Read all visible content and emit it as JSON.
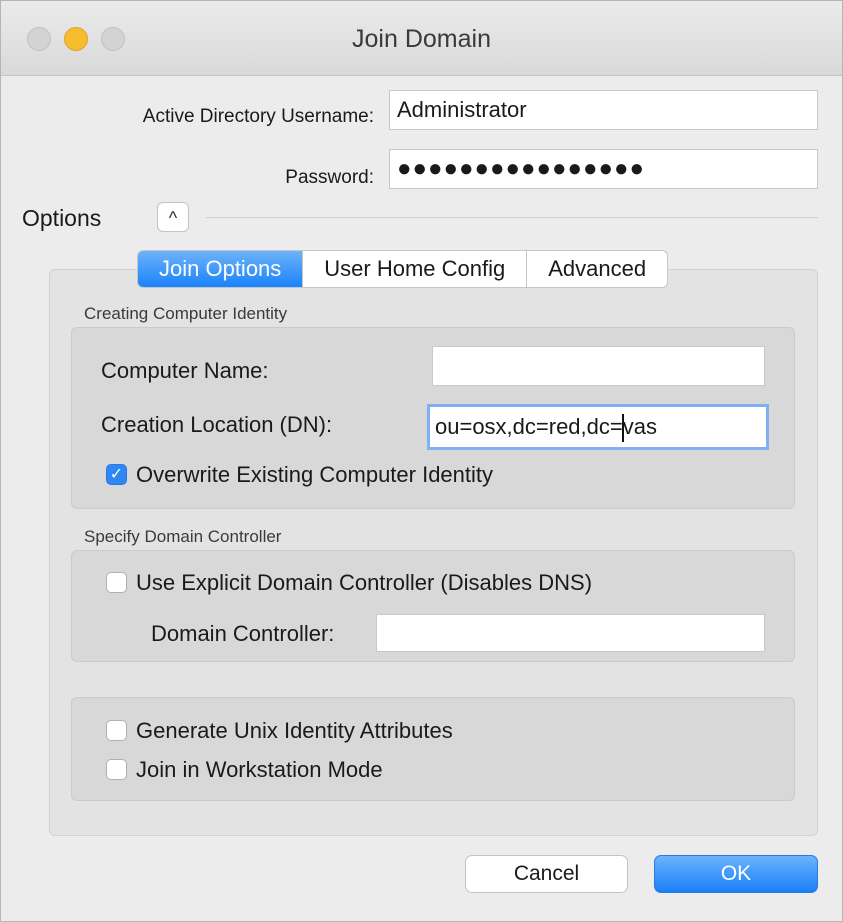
{
  "window": {
    "title": "Join Domain"
  },
  "credentials": {
    "username_label": "Active Directory Username:",
    "username_value": "Administrator",
    "password_label": "Password:",
    "password_value": "●●●●●●●●●●●●●●●●"
  },
  "options": {
    "label": "Options",
    "toggle_glyph": "^"
  },
  "tabs": [
    {
      "label": "Join Options",
      "active": true
    },
    {
      "label": "User Home Config",
      "active": false
    },
    {
      "label": "Advanced",
      "active": false
    }
  ],
  "identity": {
    "section_title": "Creating Computer Identity",
    "computer_name_label": "Computer Name:",
    "computer_name_value": "",
    "location_label": "Creation Location (DN):",
    "location_value_before_caret": "ou=osx,dc=red,dc=",
    "location_value_after_caret": "vas",
    "overwrite_label": "Overwrite Existing Computer Identity",
    "overwrite_checked": true
  },
  "domain_controller": {
    "section_title": "Specify Domain Controller",
    "explicit_label": "Use Explicit Domain Controller (Disables DNS)",
    "explicit_checked": false,
    "controller_label": "Domain Controller:",
    "controller_value": ""
  },
  "misc": {
    "unix_label": "Generate Unix Identity Attributes",
    "unix_checked": false,
    "workstation_label": "Join in Workstation Mode",
    "workstation_checked": false
  },
  "buttons": {
    "cancel": "Cancel",
    "ok": "OK"
  },
  "colors": {
    "accent": "#1a82fb",
    "minimize": "#f6be2f"
  }
}
